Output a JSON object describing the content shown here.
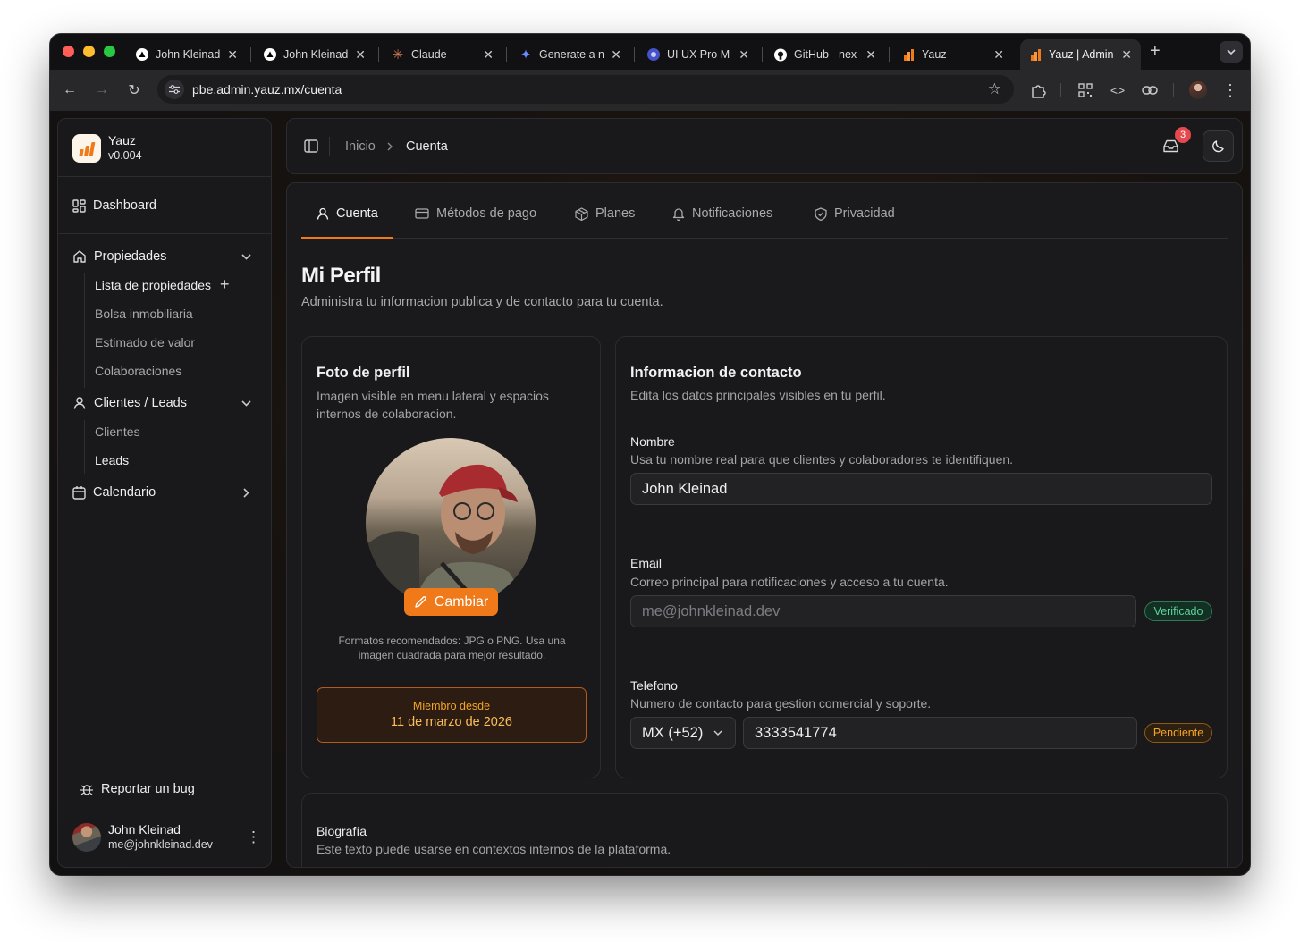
{
  "browser": {
    "tabs": [
      {
        "title": "John Kleinad",
        "icon": "vercel-icon"
      },
      {
        "title": "John Kleinad",
        "icon": "vercel-icon"
      },
      {
        "title": "Claude",
        "icon": "claude-icon"
      },
      {
        "title": "Generate a n",
        "icon": "gemini-icon"
      },
      {
        "title": "UI UX Pro M",
        "icon": "uiux-icon"
      },
      {
        "title": "GitHub - nex",
        "icon": "github-icon"
      },
      {
        "title": "Yauz",
        "icon": "yauz-icon"
      },
      {
        "title": "Yauz | Admin",
        "icon": "yauz-icon"
      }
    ],
    "url": "pbe.admin.yauz.mx/cuenta"
  },
  "sidebar": {
    "brand_name": "Yauz",
    "brand_version": "v0.004",
    "dashboard": "Dashboard",
    "propiedades": "Propiedades",
    "prop_items": [
      "Lista de propiedades",
      "Bolsa inmobiliaria",
      "Estimado de valor",
      "Colaboraciones"
    ],
    "clientes": "Clientes / Leads",
    "client_items": [
      "Clientes",
      "Leads"
    ],
    "calendario": "Calendario",
    "report_bug": "Reportar un bug",
    "user_name": "John Kleinad",
    "user_email": "me@johnkleinad.dev"
  },
  "header": {
    "crumb_home": "Inicio",
    "crumb_current": "Cuenta",
    "notification_count": "3"
  },
  "tabs": [
    "Cuenta",
    "Métodos de pago",
    "Planes",
    "Notificaciones",
    "Privacidad"
  ],
  "profile": {
    "title": "Mi Perfil",
    "subtitle": "Administra tu informacion publica y de contacto para tu cuenta."
  },
  "photo_card": {
    "title": "Foto de perfil",
    "desc": "Imagen visible en menu lateral y espacios internos de colaboracion.",
    "change_button": "Cambiar",
    "formats": "Formatos recomendados: JPG o PNG. Usa una imagen cuadrada para mejor resultado.",
    "member_label": "Miembro desde",
    "member_date": "11 de marzo de 2026"
  },
  "contact_card": {
    "title": "Informacion de contacto",
    "desc": "Edita los datos principales visibles en tu perfil.",
    "name_label": "Nombre",
    "name_hint": "Usa tu nombre real para que clientes y colaboradores te identifiquen.",
    "name_value": "John Kleinad",
    "email_label": "Email",
    "email_hint": "Correo principal para notificaciones y acceso a tu cuenta.",
    "email_value": "me@johnkleinad.dev",
    "email_badge": "Verificado",
    "phone_label": "Telefono",
    "phone_hint": "Numero de contacto para gestion comercial y soporte.",
    "country_code": "MX (+52)",
    "phone_value": "3333541774",
    "phone_badge": "Pendiente"
  },
  "bio_card": {
    "title": "Biografía",
    "desc": "Este texto puede usarse en contextos internos de la plataforma."
  },
  "colors": {
    "accent": "#f07a1a",
    "verified": "#5fd39a",
    "pending": "#f5a524",
    "badge_red": "#e5484d"
  }
}
